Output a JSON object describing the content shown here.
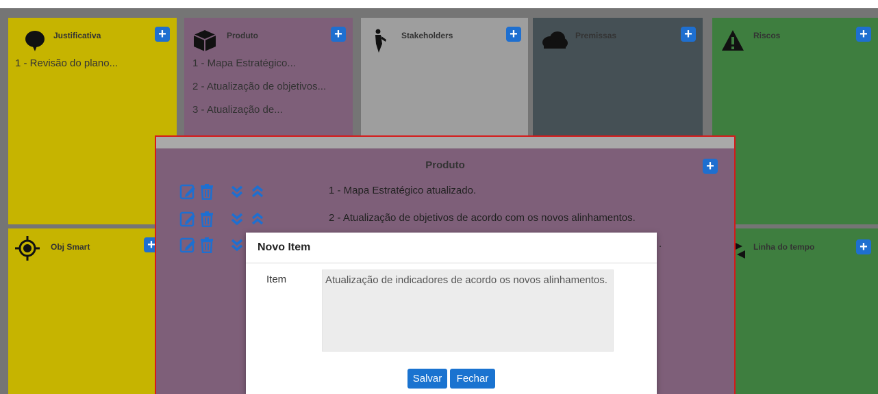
{
  "colors": {
    "background": "#757575",
    "yellow": "#c6b400",
    "purple": "#7e5f79",
    "light_gray": "#9e9e9e",
    "dark_slate": "#455055",
    "green": "#3e7e3f",
    "accent": "#1e6fd0",
    "highlight_border": "#d51a1a"
  },
  "board": {
    "top_row": [
      {
        "title": "Justificativa",
        "icon": "speech-bubble-icon",
        "items": [
          "1 - Revisão do plano..."
        ]
      },
      {
        "title": "Produto",
        "icon": "box-icon",
        "items": [
          "1 - Mapa Estratégico...",
          "2 - Atualização de objetivos...",
          "3 - Atualização de..."
        ]
      },
      {
        "title": "Stakeholders",
        "icon": "person-tie-icon",
        "items": []
      },
      {
        "title": "Premissas",
        "icon": "cloud-icon",
        "items": []
      },
      {
        "title": "Riscos",
        "icon": "warning-icon",
        "items": []
      }
    ],
    "bottom_row": [
      {
        "title": "Obj Smart",
        "icon": "target-icon"
      },
      {
        "title": "Linha do tempo",
        "icon": "arrows-icon"
      }
    ]
  },
  "product_modal": {
    "title": "Produto",
    "items": [
      "1 - Mapa Estratégico atualizado.",
      "2 - Atualização de objetivos de acordo com os novos alinhamentos.",
      "."
    ]
  },
  "dialog": {
    "title": "Novo Item",
    "field_label": "Item",
    "field_value": "Atualização de indicadores de acordo os novos alinhamentos.",
    "save_label": "Salvar",
    "close_label": "Fechar"
  }
}
